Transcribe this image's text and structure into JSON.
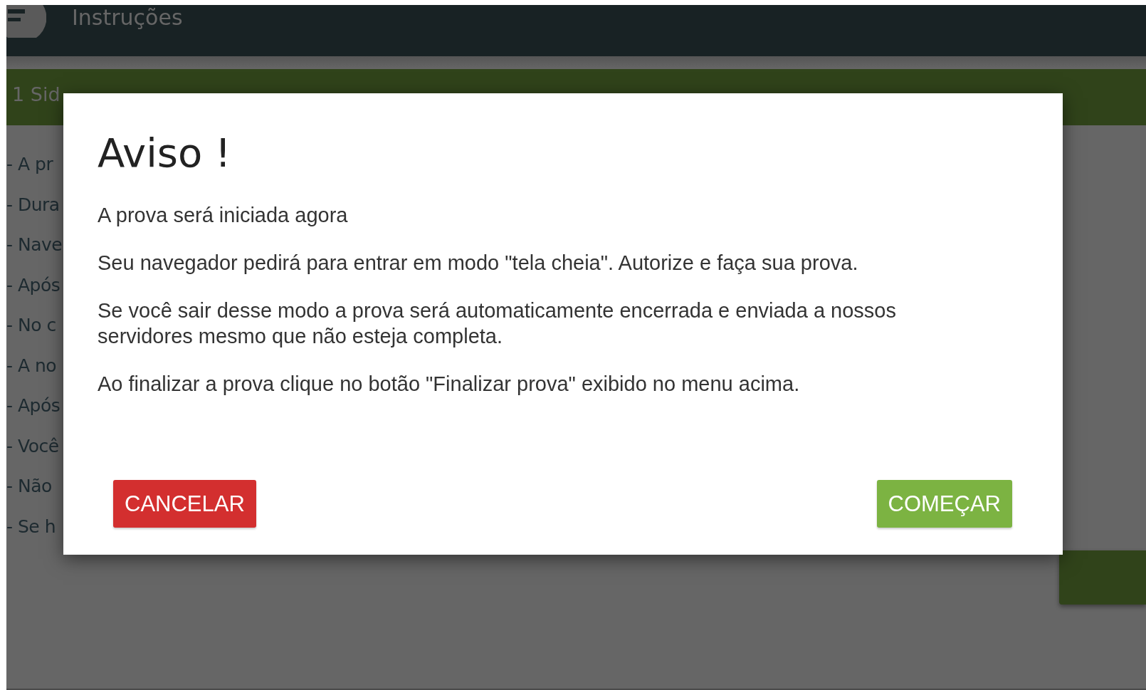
{
  "header": {
    "title": "Instruções"
  },
  "exam_bar": {
    "text": "1 Sid"
  },
  "instructions": [
    "- A pr",
    "- Dura",
    "- Nave",
    "- Após",
    "- No c",
    "- A no",
    "- Após",
    "- Você",
    "- Não",
    "- Se h"
  ],
  "dialog": {
    "title": "Aviso !",
    "paragraphs": [
      "A prova será iniciada agora",
      "Seu navegador pedirá para entrar em modo \"tela cheia\". Autorize e faça sua prova.",
      "Se você sair desse modo a prova será automaticamente encerrada e enviada a nossos servidores mesmo que não esteja completa.",
      "Ao finalizar a prova clique no botão \"Finalizar prova\" exibido no menu acima."
    ],
    "buttons": [
      {
        "label": "CANCELAR",
        "kind": "cancel"
      },
      {
        "label": "COMEÇAR",
        "kind": "confirm"
      }
    ]
  }
}
